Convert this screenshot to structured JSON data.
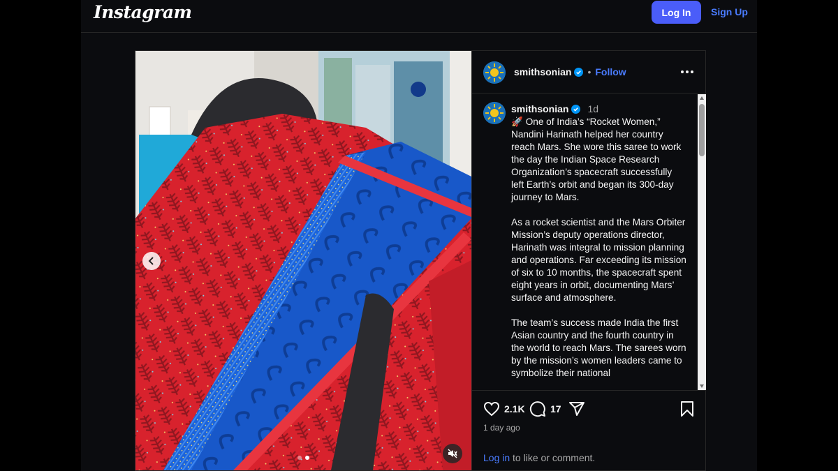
{
  "topbar": {
    "logo": "Instagram",
    "login_label": "Log In",
    "signup_label": "Sign Up"
  },
  "colors": {
    "accent": "#4a5df9",
    "link": "#4a7cff",
    "background": "#000000"
  },
  "post": {
    "username": "smithsonian",
    "separator": "•",
    "follow_label": "Follow",
    "caption_time": "1d",
    "caption": "🚀 One of India’s “Rocket Women,” Nandini Harinath helped her country reach Mars. She wore this saree to work the day the Indian Space Research Organization’s spacecraft successfully left Earth’s orbit and began its 300-day journey to Mars.\n\nAs a rocket scientist and the Mars Orbiter Mission’s deputy operations director, Harinath was integral to mission planning and operations. Far exceeding its mission of six to 10 months, the spacecraft spent eight years in orbit, documenting Mars’ surface and atmosphere.\n\nThe team’s success made India the first Asian country and the fourth country in the world to reach Mars. The sarees worn by the mission’s women leaders came to symbolize their national",
    "likes": "2.1K",
    "comments": "17",
    "time_ago": "1 day ago",
    "login_link": "Log in",
    "login_suffix": " to like or comment.",
    "carousel": {
      "count": 2,
      "active_index": 1
    },
    "icons": [
      "verified-badge-icon",
      "more-options-icon",
      "heart-icon",
      "comment-icon",
      "share-icon",
      "bookmark-icon",
      "chevron-left-icon",
      "mute-icon"
    ]
  }
}
